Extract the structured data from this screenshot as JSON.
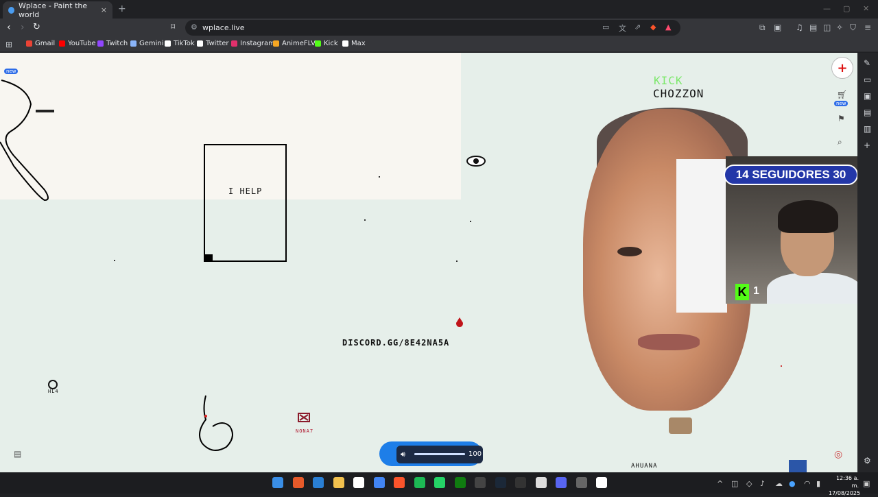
{
  "browser": {
    "tab_title": "Wplace - Paint the world",
    "tab_close": "×",
    "new_tab": "+",
    "url": "wplace.live",
    "bookmarks": [
      {
        "label": "Gmail",
        "color": "#ea4335"
      },
      {
        "label": "YouTube",
        "color": "#ff0000"
      },
      {
        "label": "Twitch",
        "color": "#9146ff"
      },
      {
        "label": "Gemini",
        "color": "#8ab4f8"
      },
      {
        "label": "TikTok",
        "color": "#ffffff"
      },
      {
        "label": "Twitter",
        "color": "#ffffff"
      },
      {
        "label": "Instagram",
        "color": "#e1306c"
      },
      {
        "label": "AnimeFLV",
        "color": "#f5a623"
      },
      {
        "label": "Kick",
        "color": "#53fc18"
      },
      {
        "label": "Max",
        "color": "#ffffff"
      }
    ]
  },
  "canvas": {
    "help_text": "I HELP",
    "discord_text": "DISCORD.GG/8E42NA5A",
    "kick_label": "KICK",
    "chozzon_label": "CHOZZON",
    "bottom_text": "AHUANA",
    "small_red_text": "NONA7",
    "left_small_text": "HL4",
    "new_badge_left": "new",
    "new_badge_right": "new"
  },
  "stream_overlay": {
    "followers_text": "14 SEGUIDORES 30",
    "kick_count": "1"
  },
  "volume": {
    "value": "100",
    "level": 1.0
  },
  "taskbar": {
    "time": "12:36 a. m.",
    "date": "17/08/2025"
  },
  "colors": {
    "canvas_bg": "#e6efea",
    "cream_bg": "#f8f6f1",
    "followers_bg": "#2337a8",
    "kick_green": "#53fc18",
    "volume_bg": "#1e7ee8"
  }
}
